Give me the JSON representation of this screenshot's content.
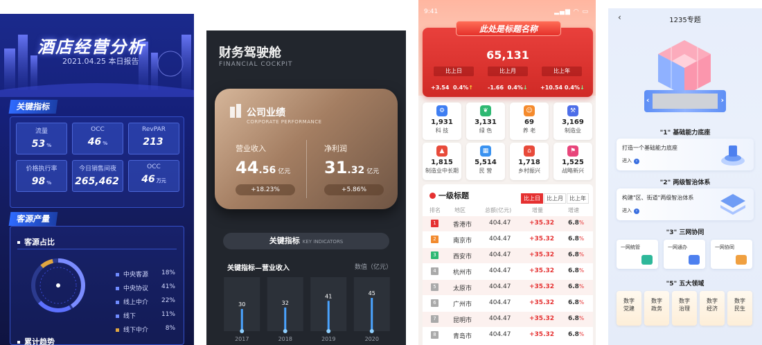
{
  "hotel": {
    "title": "酒店经营分析",
    "subtitle": "2021.04.25 本日报告",
    "kpi_section": "关键指标",
    "kpis": [
      {
        "label": "流量",
        "value": "53",
        "unit": "%"
      },
      {
        "label": "OCC",
        "value": "46",
        "unit": "%"
      },
      {
        "label": "RevPAR",
        "value": "213",
        "unit": ""
      },
      {
        "label": "价格执行率",
        "value": "98",
        "unit": "%"
      },
      {
        "label": "今日销售间夜",
        "value": "265,462",
        "unit": ""
      },
      {
        "label": "OCC",
        "value": "46",
        "unit": "万元"
      }
    ],
    "source_section": "客源产量",
    "share_title": "客源占比",
    "share_legend": [
      {
        "label": "中央客源",
        "pct": "18%"
      },
      {
        "label": "中央协议",
        "pct": "41%"
      },
      {
        "label": "线上中介",
        "pct": "22%"
      },
      {
        "label": "线下",
        "pct": "11%"
      },
      {
        "label": "线下中介",
        "pct": "8%"
      }
    ],
    "trend_title": "累计趋势",
    "colors": {
      "accent": "#2f6bff",
      "bg": "#15207a"
    }
  },
  "finance": {
    "title": "财务驾驶舱",
    "subtitle": "FINANCIAL COCKPIT",
    "card_title": "公司业绩",
    "card_subtitle": "CORPORATE PERFORMANCE",
    "metrics": [
      {
        "label": "营业收入",
        "int": "44",
        "dec": ".56",
        "unit": "亿元",
        "change": "+18.23%"
      },
      {
        "label": "净利润",
        "int": "31",
        "dec": ".32",
        "unit": "亿元",
        "change": "+5.86%"
      }
    ],
    "ki_label": "关键指标",
    "ki_en": "KEY INDICATORS",
    "chart_title": "关键指标—营业收入",
    "chart_unit": "数值（亿元）",
    "chart_data": {
      "type": "bar",
      "categories": [
        "2017",
        "2018",
        "2019",
        "2020"
      ],
      "values": [
        30,
        32,
        41,
        45
      ],
      "title": "关键指标—营业收入",
      "ylabel": "数值（亿元）",
      "ylim": [
        0,
        60
      ]
    }
  },
  "redboard": {
    "time": "9:41",
    "title": "此处是标题名称",
    "big_value": "65,131",
    "compares": [
      {
        "label": "比上日",
        "value": "+3.54",
        "pct": "0.4%",
        "dir": "up"
      },
      {
        "label": "比上月",
        "value": "-1.66",
        "pct": "0.4%",
        "dir": "down"
      },
      {
        "label": "比上年",
        "value": "+10.54",
        "pct": "0.4%",
        "dir": "down"
      }
    ],
    "cells": [
      {
        "value": "1,931",
        "label": "科 技",
        "icon": "gear-icon",
        "color": "#3e7ef2"
      },
      {
        "value": "3,131",
        "label": "绿 色",
        "icon": "leaf-icon",
        "color": "#2eb872"
      },
      {
        "value": "69",
        "label": "养 老",
        "icon": "elder-icon",
        "color": "#f58a2c"
      },
      {
        "value": "3,169",
        "label": "制造业",
        "icon": "factory-icon",
        "color": "#4d6ee8"
      },
      {
        "value": "1,815",
        "label": "制造业中长期",
        "icon": "chart-icon",
        "color": "#e84a3a"
      },
      {
        "value": "5,514",
        "label": "民 营",
        "icon": "building-icon",
        "color": "#3a92f0"
      },
      {
        "value": "1,718",
        "label": "乡村振兴",
        "icon": "house-icon",
        "color": "#e84a3a"
      },
      {
        "value": "1,525",
        "label": "战略新兴",
        "icon": "flag-icon",
        "color": "#e8457a"
      }
    ],
    "table_title": "一级标题",
    "tabs": [
      "比上日",
      "比上月",
      "比上年"
    ],
    "headers": [
      "排名",
      "地区",
      "总额(亿元)",
      "增量",
      "增速"
    ],
    "rows": [
      {
        "rank": "1",
        "city": "香港市",
        "total": "404.47",
        "inc": "+35.32",
        "rate": "6.8",
        "pct": "%"
      },
      {
        "rank": "2",
        "city": "南京市",
        "total": "404.47",
        "inc": "+35.32",
        "rate": "6.8",
        "pct": "%"
      },
      {
        "rank": "3",
        "city": "西安市",
        "total": "404.47",
        "inc": "+35.32",
        "rate": "6.8",
        "pct": "%"
      },
      {
        "rank": "4",
        "city": "杭州市",
        "total": "404.47",
        "inc": "+35.32",
        "rate": "6.8",
        "pct": "%"
      },
      {
        "rank": "5",
        "city": "太原市",
        "total": "404.47",
        "inc": "+35.32",
        "rate": "6.8",
        "pct": "%"
      },
      {
        "rank": "6",
        "city": "广州市",
        "total": "404.47",
        "inc": "+35.32",
        "rate": "6.8",
        "pct": "%"
      },
      {
        "rank": "7",
        "city": "昆明市",
        "total": "404.47",
        "inc": "+35.32",
        "rate": "6.8",
        "pct": "%"
      },
      {
        "rank": "8",
        "city": "青岛市",
        "total": "404.47",
        "inc": "+35.32",
        "rate": "6.8",
        "pct": "%"
      }
    ],
    "rank_colors": [
      "#e53030",
      "#f28a2e",
      "#2eb872",
      "#a9a9a9"
    ]
  },
  "topic": {
    "nav_title": "1235专题",
    "sec1": "\"1\" 基础能力底座",
    "card1": "打造一个基础能力底座",
    "enter": "进入",
    "sec2": "\"2\" 两级智治体系",
    "card2": "构建\"区、街道\"两级智治体系",
    "sec3": "\"3\" 三网协同",
    "nets": [
      "一网统管",
      "一网通办",
      "一网协同"
    ],
    "sec5": "\"5\" 五大领域",
    "domains": [
      [
        "数字",
        "党建"
      ],
      [
        "数字",
        "政务"
      ],
      [
        "数字",
        "治理"
      ],
      [
        "数字",
        "经济"
      ],
      [
        "数字",
        "民生"
      ]
    ]
  }
}
